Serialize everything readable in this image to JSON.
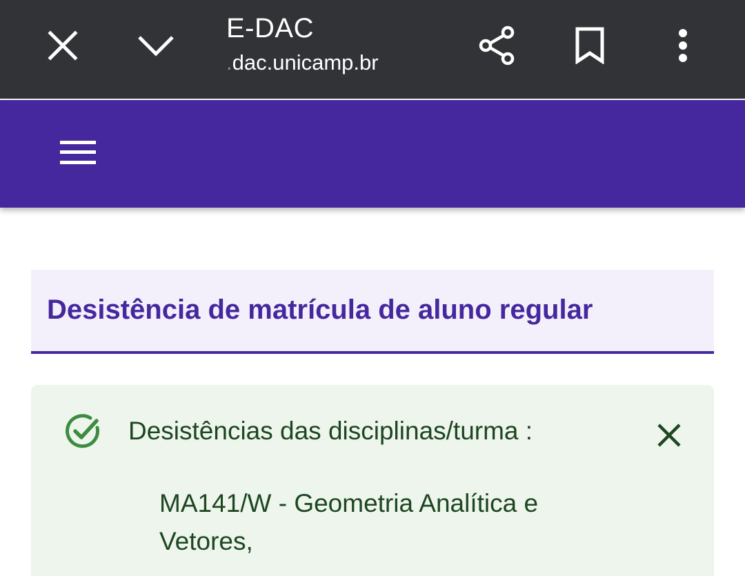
{
  "browser": {
    "page_title": "E-DAC",
    "url_prefix": ".",
    "url": "dac.unicamp.br",
    "icons": {
      "close": "close-icon",
      "minimize": "chevron-down-icon",
      "share": "share-icon",
      "bookmark": "bookmark-icon",
      "more": "more-vertical-icon"
    },
    "colors": {
      "toolbar_bg": "#323336",
      "icon": "#ffffff"
    }
  },
  "app_header": {
    "menu_icon": "hamburger-menu-icon",
    "colors": {
      "bg": "#46289e"
    }
  },
  "section": {
    "title": "Desistência de matrícula de aluno regular",
    "colors": {
      "title": "#46289e",
      "bg": "#f3f0fc"
    }
  },
  "alert": {
    "type": "success",
    "icon": "check-circle-icon",
    "title": "Desistências das disciplinas/turma :",
    "items": [
      "MA141/W - Geometria Analítica e Vetores,"
    ],
    "dismiss_icon": "close-icon",
    "colors": {
      "bg": "#edf5ec",
      "text": "#1d4621",
      "icon": "#3d8b40"
    }
  }
}
